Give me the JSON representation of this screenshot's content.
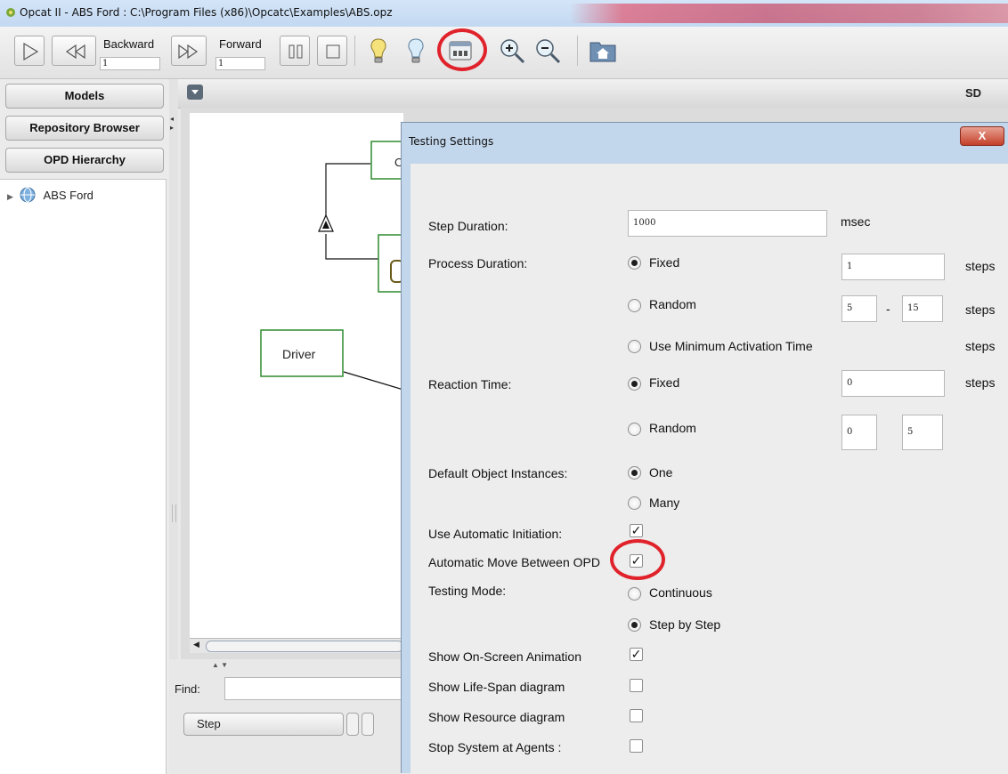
{
  "window": {
    "title": "Opcat II - ABS Ford : C:\\Program Files (x86)\\Opcatc\\Examples\\ABS.opz"
  },
  "toolbar": {
    "backward_label": "Backward",
    "backward_value": "1",
    "forward_label": "Forward",
    "forward_value": "1"
  },
  "sidebar": {
    "models_label": "Models",
    "repository_label": "Repository Browser",
    "opd_hierarchy_label": "OPD Hierarchy",
    "tree_root": "ABS Ford"
  },
  "main": {
    "view_label": "SD",
    "diagram": {
      "driver_label": "Driver",
      "partial_label": "C"
    }
  },
  "bottom": {
    "find_label": "Find:",
    "find_value": "",
    "step_select_value": "Step"
  },
  "dialog": {
    "title": "Testing Settings",
    "close_label": "X",
    "step_duration_label": "Step Duration:",
    "step_duration_value": "1000",
    "msec_unit": "msec",
    "process_duration_label": "Process Duration:",
    "fixed_label": "Fixed",
    "process_fixed_value": "1",
    "steps_unit": "steps",
    "random_label": "Random",
    "process_random_min": "5",
    "range_dash": "-",
    "process_random_max": "15",
    "use_min_activation_label": "Use Minimum Activation Time",
    "reaction_time_label": "Reaction Time:",
    "reaction_fixed_value": "0",
    "reaction_random_min": "0",
    "reaction_random_max": "5",
    "default_instances_label": "Default Object Instances:",
    "one_label": "One",
    "many_label": "Many",
    "auto_initiation_label": "Use Automatic Initiation:",
    "auto_initiation_checked": true,
    "auto_move_label": "Automatic Move Between OPD",
    "auto_move_checked": true,
    "testing_mode_label": "Testing Mode:",
    "continuous_label": "Continuous",
    "step_by_step_label": "Step by Step",
    "show_animation_label": "Show On-Screen Animation",
    "show_animation_checked": true,
    "show_lifespan_label": "Show Life-Span diagram",
    "show_lifespan_checked": false,
    "show_resource_label": "Show Resource diagram",
    "show_resource_checked": false,
    "stop_agents_label": "Stop System at Agents :",
    "stop_agents_checked": false
  },
  "colors": {
    "highlight_ring": "#e0222b",
    "diagram_object_border": "#2e8b2e"
  }
}
